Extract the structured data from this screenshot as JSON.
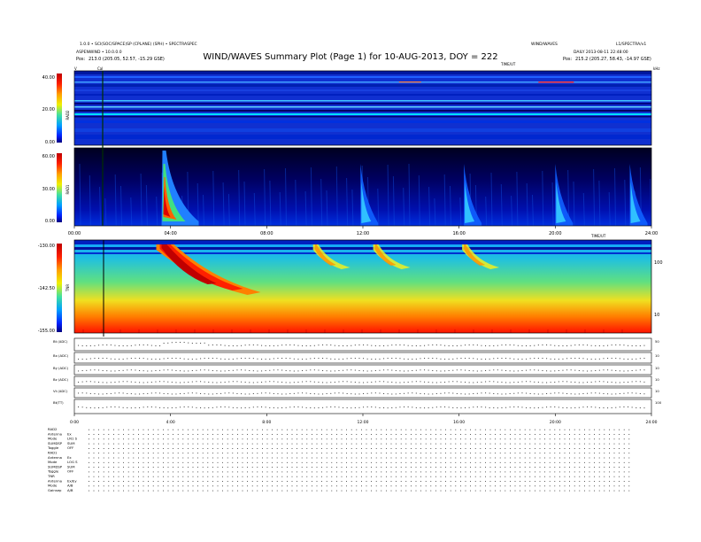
{
  "header": {
    "left_line1": "1.0.0 • SCI(SOC/SPACE)SP (CPLANE) (SPH) • SPECTRASPEC",
    "left_line2": "ASPENWIND • 10.0.0.0",
    "left_line3_label": "Pos:",
    "left_line3_value": "213.0 (205.05, 52.57, -15.29 GSE)",
    "title": "WIND/WAVES Summary Plot (Page 1) for 10-AUG-2013, DOY = 222",
    "right_line1": "WIND/WAVES",
    "right_line1b": "L1/SPECTRA/v1",
    "right_line2": "DAILY 2013-08-11 22:48:00",
    "right_line3_label": "Pos:",
    "right_line3_value": "215.2 (205.27, 58.43, -14.97 GSE)",
    "marker_label": "TIME/UT",
    "panel_corner_left": "V",
    "panel_corner_cal": "Cal",
    "panel_corner_right": "kHz"
  },
  "colors": {
    "bg_blue": "#1030d0",
    "deep_blue": "#000090",
    "dark_navy": "#000020",
    "panel_border": "#000000"
  },
  "panels": {
    "rad2": {
      "name": "RAD2",
      "ticks": [
        "40.00",
        "20.00",
        "0.00"
      ]
    },
    "rad1": {
      "name": "RAD1",
      "ticks": [
        "60.00",
        "30.00",
        "0.00"
      ]
    },
    "tnr": {
      "name": "TNR",
      "ticks": [
        "-130.00",
        "-142.50",
        "-155.00"
      ],
      "right_ticks": [
        "100",
        "10"
      ]
    }
  },
  "time_axis": {
    "label": "TIME/UT",
    "ticks_mid": [
      "00:00",
      "04:00",
      "08:00",
      "12:00",
      "16:00",
      "20:00",
      "24:00"
    ],
    "ticks_bottom": [
      "0:00",
      "4:00",
      "8:00",
      "12:00",
      "16:00",
      "20:00",
      "24:00"
    ]
  },
  "housekeeping": [
    {
      "label": "Bt (ADC)",
      "right": "50"
    },
    {
      "label": "Bx (ADC)",
      "right": "10"
    },
    {
      "label": "By (ADC)",
      "right": "10"
    },
    {
      "label": "Bz (ADC)",
      "right": "10"
    },
    {
      "label": "Vt (ADC)",
      "right": "10"
    },
    {
      "label": "Bt(TT)",
      "right": "100"
    }
  ],
  "info_block": [
    {
      "k": "RAD2",
      "v": ""
    },
    {
      "k": "Antenna",
      "v": "Ex"
    },
    {
      "k": "Mode",
      "v": "LN1 S"
    },
    {
      "k": "SUMDSP",
      "v": "SUM"
    },
    {
      "k": "Toggle",
      "v": "OFF"
    },
    {
      "k": "RAD1",
      "v": ""
    },
    {
      "k": "Antenna",
      "v": "Ex"
    },
    {
      "k": "Mode",
      "v": "LOG S"
    },
    {
      "k": "SUMDSP",
      "v": "SUM"
    },
    {
      "k": "Toggle",
      "v": "OFF"
    },
    {
      "k": "TNR",
      "v": ""
    },
    {
      "k": "Antenna",
      "v": "Ex/Ey"
    },
    {
      "k": "Mode",
      "v": "A/B"
    },
    {
      "k": "Gainsep",
      "v": "A/B"
    }
  ],
  "chart_data": [
    {
      "type": "heatmap",
      "title": "RAD2",
      "ylim": [
        0,
        40
      ],
      "x": [
        "00:00",
        "24:00"
      ],
      "colorbar_ticks": [
        40.0,
        20.0,
        0.0
      ]
    },
    {
      "type": "heatmap",
      "title": "RAD1",
      "ylim": [
        0,
        60
      ],
      "x": [
        "00:00",
        "24:00"
      ],
      "colorbar_ticks": [
        60.0,
        30.0,
        0.0
      ],
      "bursts_hours": [
        3.7,
        11.9,
        16.2,
        20.0,
        23.1
      ]
    },
    {
      "type": "heatmap",
      "title": "TNR",
      "ylim": [
        -155,
        -130
      ],
      "x": [
        "00:00",
        "24:00"
      ],
      "colorbar_ticks": [
        -130.0,
        -142.5,
        -155.0
      ],
      "right_axis_ticks": [
        100,
        10
      ],
      "bursts_hours": [
        3.7,
        10.0,
        12.5,
        16.2
      ]
    }
  ]
}
